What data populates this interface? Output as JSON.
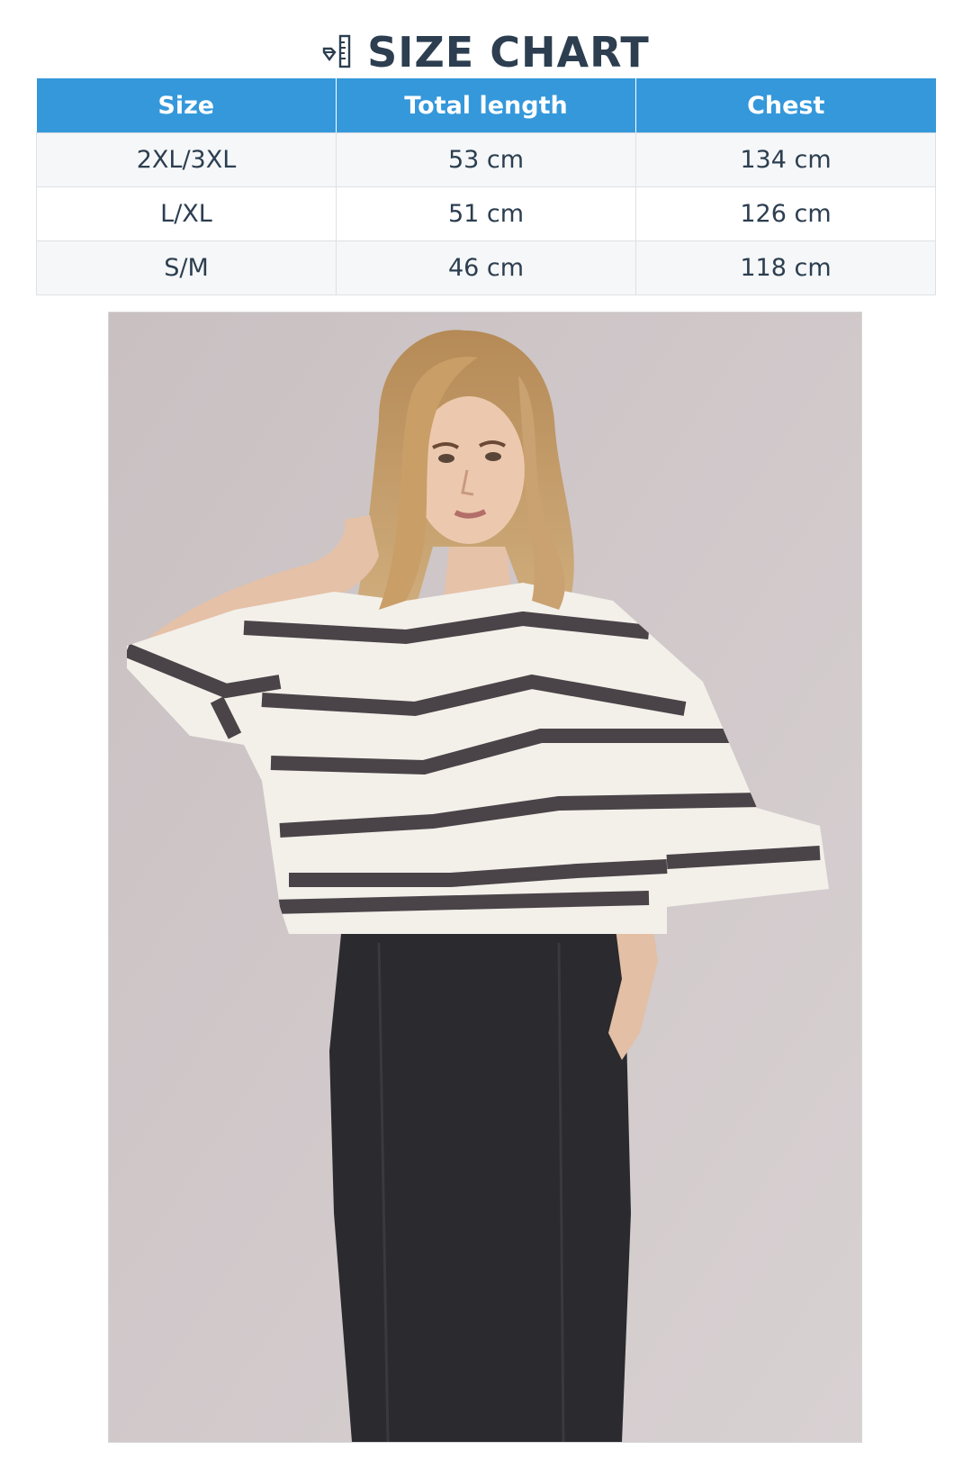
{
  "header": {
    "title": "SIZE CHART",
    "icon": "ruler-diamond-icon"
  },
  "table": {
    "columns": [
      "Size",
      "Total length",
      "Chest"
    ],
    "rows": [
      {
        "size": "2XL/3XL",
        "total_length": "53 cm",
        "chest": "134 cm"
      },
      {
        "size": "L/XL",
        "total_length": "51 cm",
        "chest": "126 cm"
      },
      {
        "size": "S/M",
        "total_length": "46 cm",
        "chest": "118 cm"
      }
    ]
  },
  "photo": {
    "icon": "product-photo"
  },
  "colors": {
    "header_bg": "#3498db",
    "text": "#2c3e50",
    "row_alt": "#f5f7f8",
    "photo_bg": "#cbc3c4",
    "stripe": "#4a4448",
    "top": "#f3f0ea",
    "skirt": "#2b2a2e"
  }
}
